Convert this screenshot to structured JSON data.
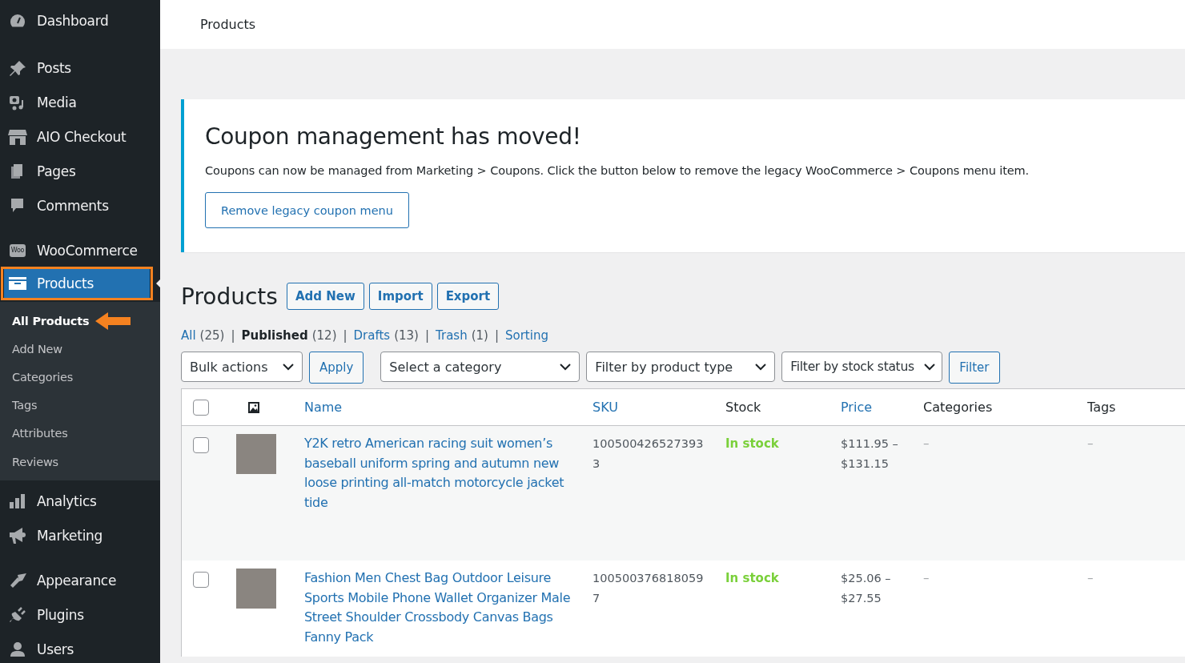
{
  "sidebar": {
    "groups": [
      [
        {
          "label": "Dashboard",
          "selected": false,
          "annotated": false
        }
      ],
      [
        {
          "label": "Posts",
          "selected": false,
          "annotated": false
        },
        {
          "label": "Media",
          "selected": false,
          "annotated": false
        },
        {
          "label": "AIO Checkout",
          "selected": false,
          "annotated": false
        },
        {
          "label": "Pages",
          "selected": false,
          "annotated": false
        },
        {
          "label": "Comments",
          "selected": false,
          "annotated": false
        }
      ],
      [
        {
          "label": "WooCommerce",
          "badge": "Woo",
          "selected": false,
          "annotated": false
        },
        {
          "label": "Products",
          "selected": true,
          "annotated": true,
          "children": [
            {
              "label": "All Products",
              "selected": true,
              "annotated": true
            },
            {
              "label": "Add New",
              "selected": false,
              "annotated": false
            },
            {
              "label": "Categories",
              "selected": false,
              "annotated": false
            },
            {
              "label": "Tags",
              "selected": false,
              "annotated": false
            },
            {
              "label": "Attributes",
              "selected": false,
              "annotated": false
            },
            {
              "label": "Reviews",
              "selected": false,
              "annotated": false
            }
          ]
        },
        {
          "label": "Analytics",
          "selected": false,
          "annotated": false
        },
        {
          "label": "Marketing",
          "selected": false,
          "annotated": false
        }
      ],
      [
        {
          "label": "Appearance",
          "selected": false,
          "annotated": false
        },
        {
          "label": "Plugins",
          "selected": false,
          "annotated": false
        },
        {
          "label": "Users",
          "selected": false,
          "annotated": false
        }
      ]
    ]
  },
  "top_bar": {
    "title": "Products"
  },
  "notice": {
    "title": "Coupon management has moved!",
    "text": "Coupons can now be managed from Marketing > Coupons. Click the button below to remove the legacy WooCommerce > Coupons menu item.",
    "button": "Remove legacy coupon menu"
  },
  "page": {
    "title": "Products",
    "actions": [
      "Add New",
      "Import",
      "Export"
    ]
  },
  "views": [
    {
      "label": "All",
      "count": "(25)",
      "selected": false
    },
    {
      "separator": "|",
      "label": "Published",
      "count": "(12)",
      "selected": true
    },
    {
      "separator": "|",
      "label": "Drafts",
      "count": "(13)",
      "selected": false
    },
    {
      "separator": "|",
      "label": "Trash",
      "count": "(1)",
      "selected": false
    },
    {
      "separator": "|",
      "label": "Sorting",
      "selected": false
    }
  ],
  "filters": {
    "bulk_actions": "Bulk actions",
    "apply": "Apply",
    "category": "Select a category",
    "product_type": "Filter by product type",
    "stock_status": "Filter by stock status",
    "filter": "Filter"
  },
  "table": {
    "select_all_checked": false,
    "columns": [
      {
        "label": "Name",
        "sortable": true
      },
      {
        "label": "SKU",
        "sortable": true
      },
      {
        "label": "Stock",
        "sortable": false
      },
      {
        "label": "Price",
        "sortable": true
      },
      {
        "label": "Categories",
        "sortable": false
      },
      {
        "label": "Tags",
        "sortable": false
      }
    ],
    "rows": [
      {
        "checked": false,
        "name": "Y2K retro American racing suit women’s baseball uniform spring and autumn new loose printing all-match motorcycle jacket tide",
        "sku": [
          "100500426527393",
          "3"
        ],
        "stock": "In stock",
        "price": [
          "$111.95 –",
          "$131.15"
        ],
        "categories": "–",
        "tags": "–"
      },
      {
        "checked": false,
        "name": "Fashion Men Chest Bag Outdoor Leisure Sports Mobile Phone Wallet Organizer Male Street Shoulder Crossbody Canvas Bags Fanny Pack",
        "sku": [
          "100500376818059",
          "7"
        ],
        "stock": "In stock",
        "price": [
          "$25.06 –",
          "$27.55"
        ],
        "categories": "–",
        "tags": "–"
      }
    ]
  }
}
